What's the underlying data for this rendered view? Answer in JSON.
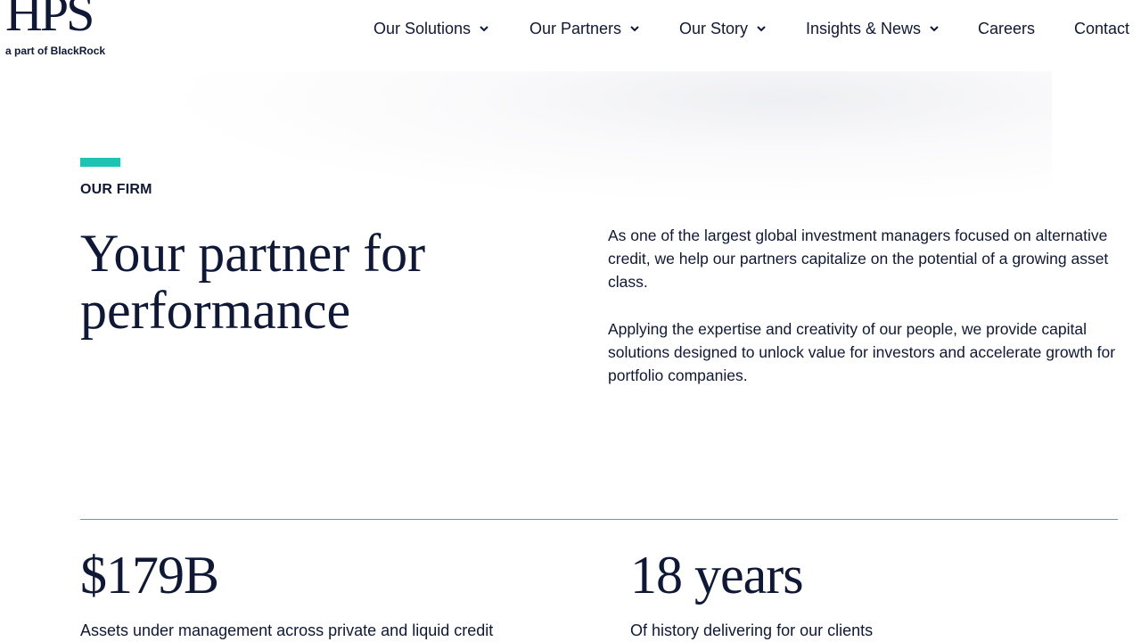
{
  "brand": {
    "mark": "HPS",
    "subtitle": "a part of BlackRock"
  },
  "nav": {
    "items": [
      {
        "label": "Our Solutions",
        "has_dropdown": true
      },
      {
        "label": "Our Partners",
        "has_dropdown": true
      },
      {
        "label": "Our Story",
        "has_dropdown": true
      },
      {
        "label": "Insights & News",
        "has_dropdown": true
      },
      {
        "label": "Careers",
        "has_dropdown": false
      },
      {
        "label": "Contact",
        "has_dropdown": false
      }
    ],
    "dropdown_icon": "chevron-down-icon"
  },
  "section": {
    "eyebrow": "OUR FIRM",
    "headline": "Your partner for performance",
    "paragraphs": [
      "As one of the largest global investment managers focused on alternative credit, we help our partners capitalize on the potential of a growing asset class.",
      "Applying the expertise and creativity of our people, we provide capital solutions designed to unlock value for investors and accelerate growth for portfolio companies."
    ]
  },
  "stats": [
    {
      "value": "$179B",
      "label": "Assets under management across private and liquid credit"
    },
    {
      "value": "18 years",
      "label": "Of history delivering for our clients"
    }
  ],
  "colors": {
    "navy": "#0f1836",
    "accent": "#1ec4b3",
    "background": "#ffffff"
  }
}
